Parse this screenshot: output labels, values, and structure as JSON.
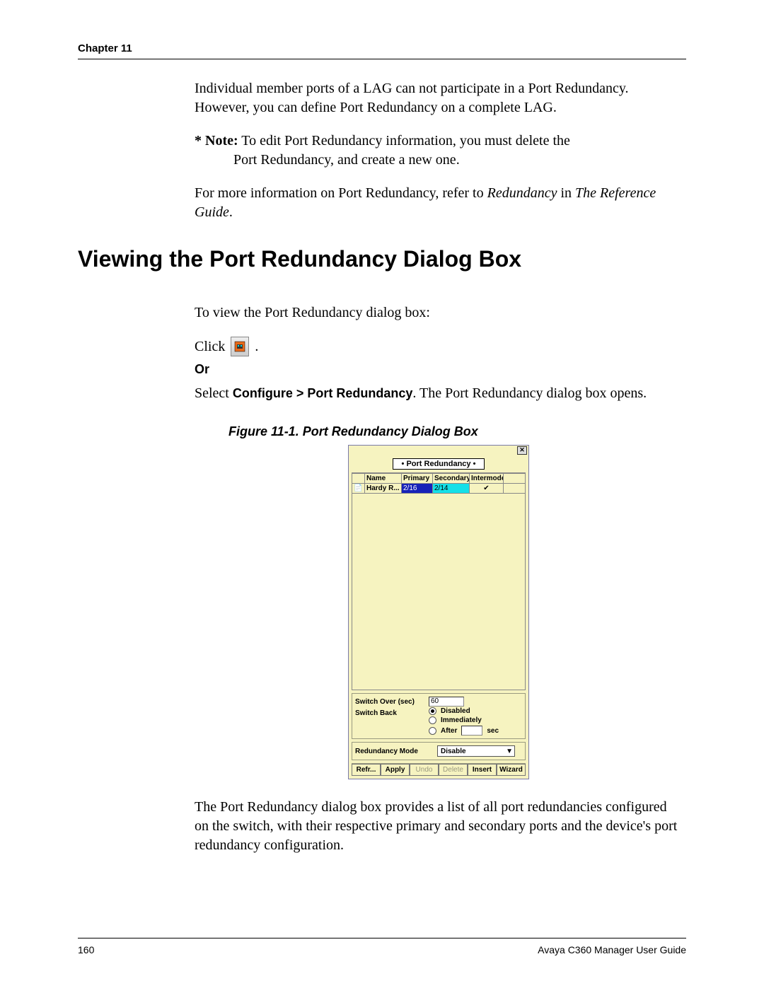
{
  "header": {
    "chapter": "Chapter 11"
  },
  "intro": {
    "p1": "Individual member ports of a LAG can not participate in a Port Redundancy. However, you can define Port Redundancy on a complete LAG.",
    "note_label": "* Note:",
    "note_text_line1": "To edit Port Redundancy information, you must delete the",
    "note_text_line2": "Port Redundancy, and create a new one.",
    "p2_pre": "For more information on Port Redundancy, refer to ",
    "p2_ital1": "Redundancy",
    "p2_mid": " in ",
    "p2_ital2": "The Reference Guide",
    "p2_post": "."
  },
  "h1": "Viewing the Port Redundancy Dialog Box",
  "view": {
    "p1": "To view the Port Redundancy dialog box:",
    "click": "Click",
    "click_after": ".",
    "or": "Or",
    "select_pre": "Select ",
    "select_menu": "Configure > Port Redundancy",
    "select_post": ". The Port Redundancy dialog box opens."
  },
  "figure_caption": "Figure 11-1. Port Redundancy Dialog Box",
  "dialog": {
    "title": "• Port Redundancy •",
    "close": "✕",
    "columns": {
      "c1": "",
      "c2": "Name",
      "c3": "Primary",
      "c4": "Secondary",
      "c5": "Intermode"
    },
    "row": {
      "icon": "📄",
      "name": "Hardy R...",
      "primary": "2/16",
      "secondary": "2/14",
      "intermode_checked": "✔"
    },
    "switch_over_label": "Switch Over (sec)",
    "switch_over_value": "60",
    "switch_back_label": "Switch Back",
    "radios": {
      "disabled": "Disabled",
      "immediately": "Immediately",
      "after": "After"
    },
    "after_unit": "sec",
    "after_value": "",
    "redundancy_mode_label": "Redundancy Mode",
    "redundancy_mode_value": "Disable",
    "buttons": {
      "refresh": "Refr...",
      "apply": "Apply",
      "undo": "Undo",
      "delete": "Delete",
      "insert": "Insert",
      "wizard": "Wizard"
    }
  },
  "after_fig": "The Port Redundancy dialog box provides a list of all port redundancies configured on the switch, with their respective primary and secondary ports and the device's port redundancy configuration.",
  "footer": {
    "page": "160",
    "doc": "Avaya C360 Manager User Guide"
  }
}
